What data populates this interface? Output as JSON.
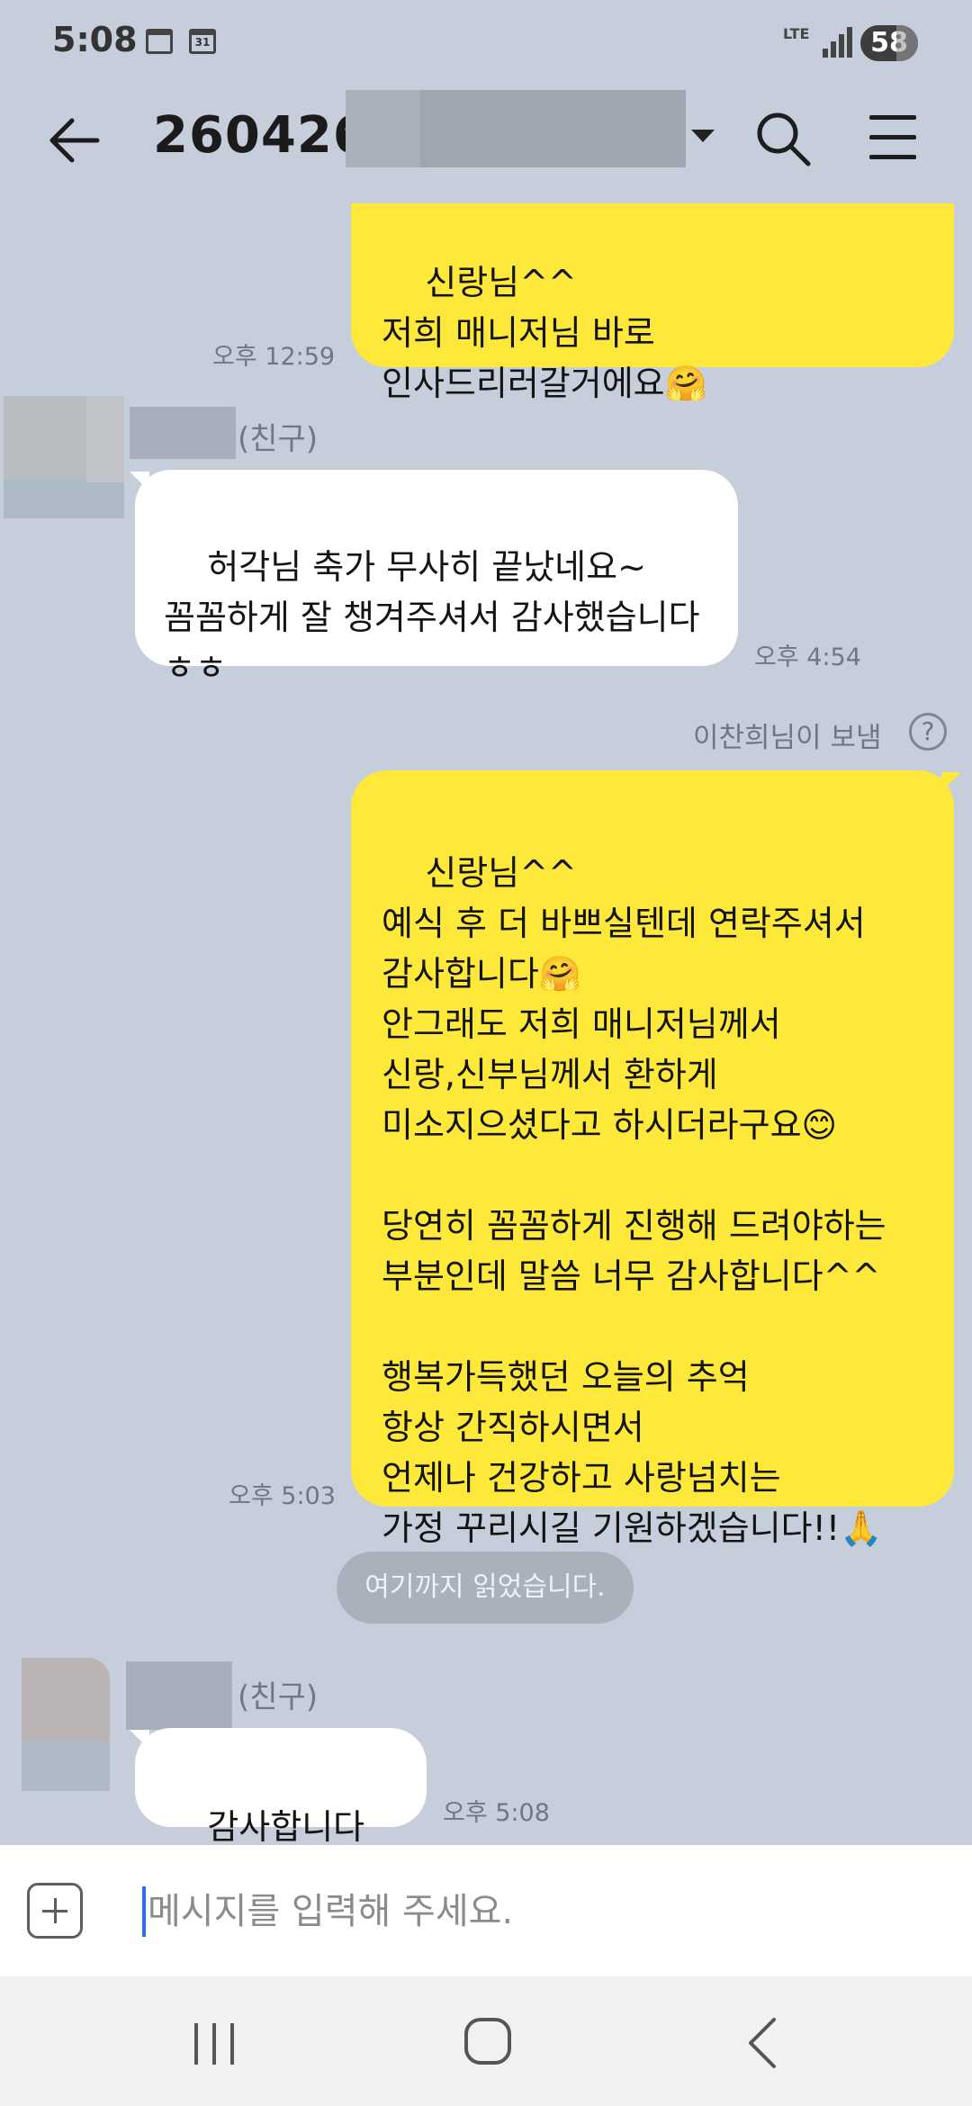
{
  "status_bar": {
    "time": "5:08",
    "calendar_day": "31",
    "network": "LTE",
    "battery": "58"
  },
  "header": {
    "title": "260426"
  },
  "messages": [
    {
      "side": "mine",
      "text": "신랑님^^\n저희 매니저님 바로\n인사드리러갈거에요🤗",
      "time": "오후 12:59"
    },
    {
      "side": "theirs",
      "sender_tag": "(친구)",
      "text": "허각님 축가 무사히 끝났네요~\n꼼꼼하게 잘 챙겨주셔서 감사했습니다\nㅎㅎ",
      "time": "오후 4:54"
    },
    {
      "side": "mine",
      "sent_by_note": "이찬희님이 보냄",
      "help_icon": "?",
      "text": "신랑님^^\n예식 후 더 바쁘실텐데 연락주셔서\n감사합니다🤗\n안그래도 저희 매니저님께서\n신랑,신부님께서 환하게\n미소지으셨다고 하시더라구요😊\n\n당연히 꼼꼼하게 진행해 드려야하는\n부분인데 말씀 너무 감사합니다^^\n\n행복가득했던 오늘의 추억\n항상 간직하시면서\n언제나 건강하고 사랑넘치는\n가정 꾸리시길 기원하겠습니다!!🙏🤗",
      "time": "오후 5:03"
    },
    {
      "side": "theirs",
      "sender_tag": "(친구)",
      "text": "감사합니다 ㅎㅎ",
      "time": "오후 5:08"
    }
  ],
  "read_marker": "여기까지 읽었습니다.",
  "input": {
    "placeholder": "메시지를 입력해 주세요.",
    "value": ""
  },
  "icons": {
    "back": "back-arrow-icon",
    "search": "search-icon",
    "menu": "hamburger-menu-icon",
    "add": "plus-icon",
    "nav_recent": "recent-apps-icon",
    "nav_home": "home-icon",
    "nav_back": "nav-back-icon"
  },
  "colors": {
    "background": "#c5ceda",
    "my_bubble": "#fee93b",
    "their_bubble": "#ffffff",
    "read_marker": "#a9b1bd",
    "cursor": "#2a6ee8"
  }
}
